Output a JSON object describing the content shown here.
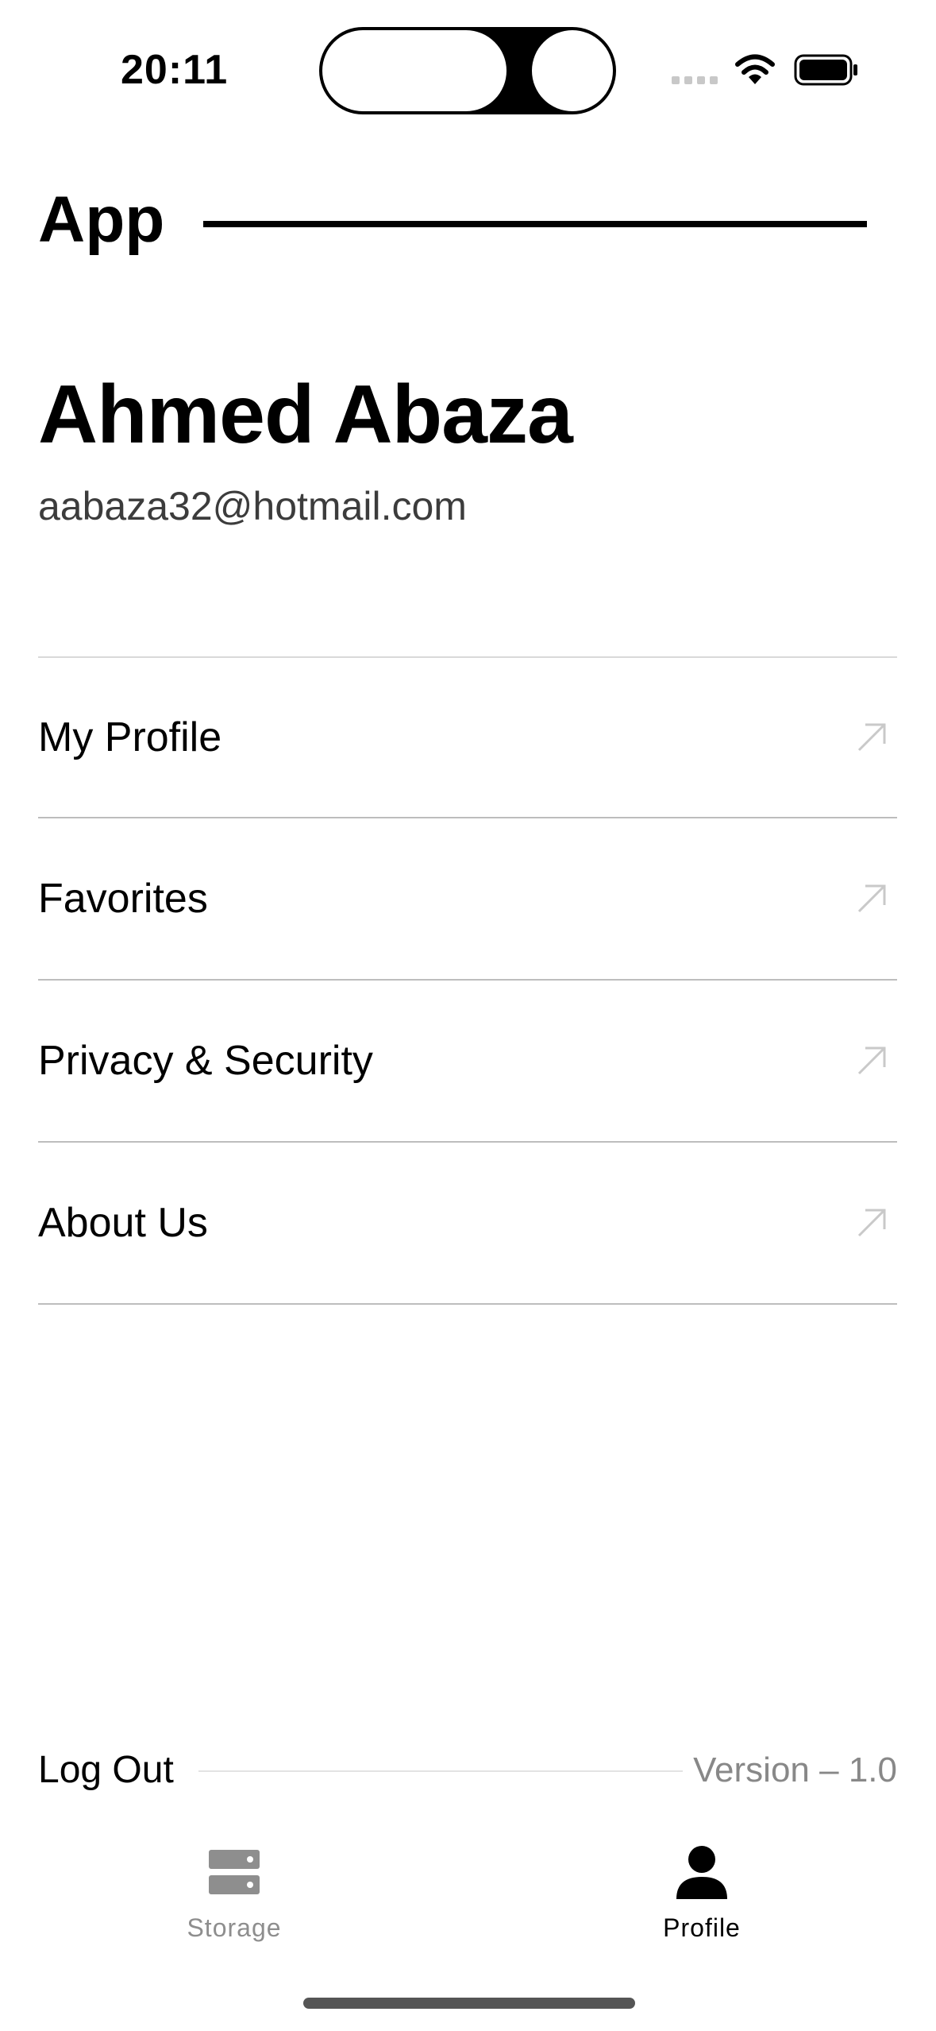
{
  "status_bar": {
    "time": "20:11",
    "icons": [
      "signal-dots-icon",
      "wifi-icon",
      "battery-icon"
    ]
  },
  "header": {
    "app_title": "App"
  },
  "user": {
    "name": "Ahmed Abaza",
    "email": "aabaza32@hotmail.com"
  },
  "menu": {
    "items": [
      {
        "label": "My Profile",
        "icon": "arrow-up-right-icon"
      },
      {
        "label": "Favorites",
        "icon": "arrow-up-right-icon"
      },
      {
        "label": "Privacy & Security",
        "icon": "arrow-up-right-icon"
      },
      {
        "label": "About Us",
        "icon": "arrow-up-right-icon"
      }
    ]
  },
  "footer": {
    "logout_label": "Log Out",
    "version_text": "Version – 1.0"
  },
  "tab_bar": {
    "tabs": [
      {
        "label": "Storage",
        "icon": "storage-icon",
        "active": false
      },
      {
        "label": "Profile",
        "icon": "person-icon",
        "active": true
      }
    ]
  },
  "colors": {
    "text_primary": "#000000",
    "text_secondary": "#3c3c3c",
    "inactive_tab": "#8e8e8e",
    "divider": "#bdbdbd",
    "version_text": "#888888"
  }
}
